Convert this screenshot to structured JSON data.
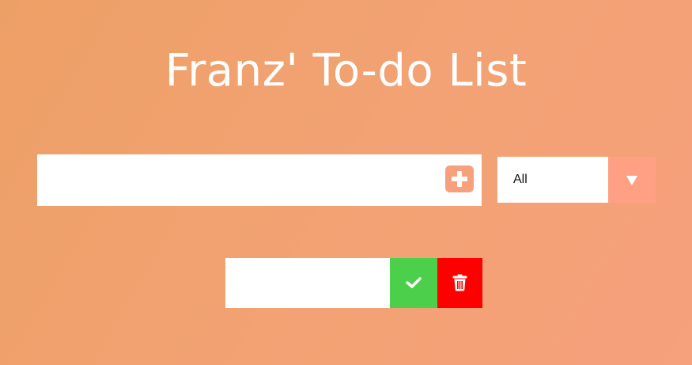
{
  "header": {
    "title": "Franz' To-do List"
  },
  "form": {
    "todo_input": {
      "value": "",
      "placeholder": ""
    },
    "add_button_icon": "plus-square-icon",
    "filter": {
      "selected": "All",
      "arrow_icon": "triangle-down-icon"
    }
  },
  "todos": [
    {
      "text": "",
      "complete_icon": "check-icon",
      "delete_icon": "trash-icon"
    }
  ],
  "colors": {
    "background_start": "#eda066",
    "background_end": "#f6a07c",
    "accent": "#f6a07c",
    "filter_arrow_bg": "#ff9f84",
    "complete_green": "#4ccf4a",
    "delete_red": "#ff0000"
  }
}
